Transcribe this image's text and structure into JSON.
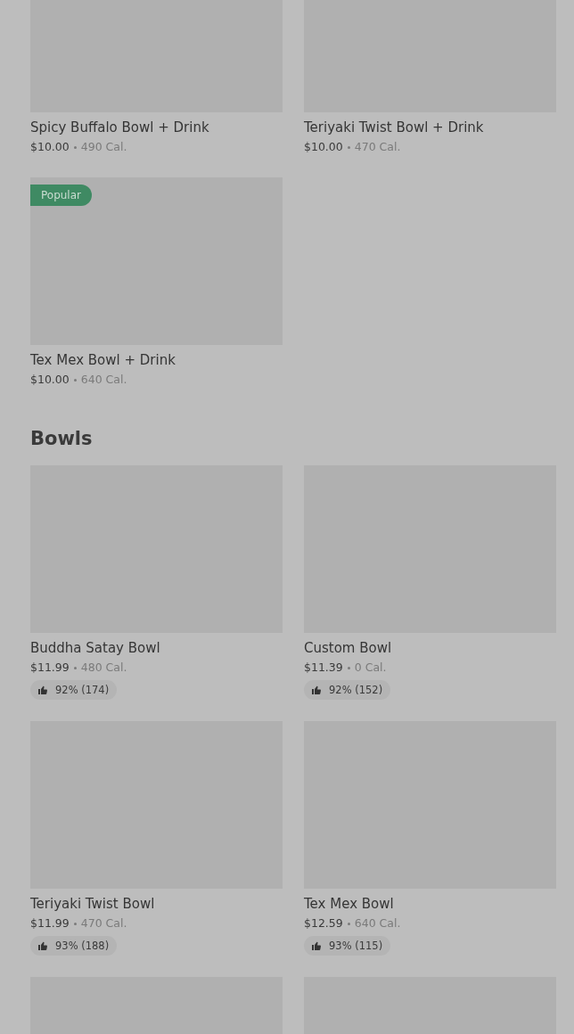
{
  "sections": [
    {
      "items": [
        {
          "kind": "full",
          "name": "Spicy Buffalo Bowl + Drink",
          "price": "$10.00",
          "calories": "490 Cal."
        },
        {
          "kind": "full",
          "name": "Teriyaki Twist Bowl + Drink",
          "price": "$10.00",
          "calories": "470 Cal."
        },
        {
          "kind": "full",
          "badge": "Popular",
          "name": "Tex Mex Bowl + Drink",
          "price": "$10.00",
          "calories": "640 Cal."
        }
      ]
    },
    {
      "title": "Bowls",
      "items": [
        {
          "kind": "full",
          "name": "Buddha Satay Bowl",
          "price": "$11.99",
          "calories": "480 Cal.",
          "rating": "92% (174)"
        },
        {
          "kind": "full",
          "name": "Custom Bowl",
          "price": "$11.39",
          "calories": "0 Cal.",
          "rating": "92% (152)"
        },
        {
          "kind": "full",
          "name": "Teriyaki Twist Bowl",
          "price": "$11.99",
          "calories": "470 Cal.",
          "rating": "93% (188)"
        },
        {
          "kind": "full",
          "name": "Tex Mex Bowl",
          "price": "$12.59",
          "calories": "640 Cal.",
          "rating": "93% (115)"
        },
        {
          "kind": "image_only"
        },
        {
          "kind": "image_only"
        }
      ]
    }
  ]
}
